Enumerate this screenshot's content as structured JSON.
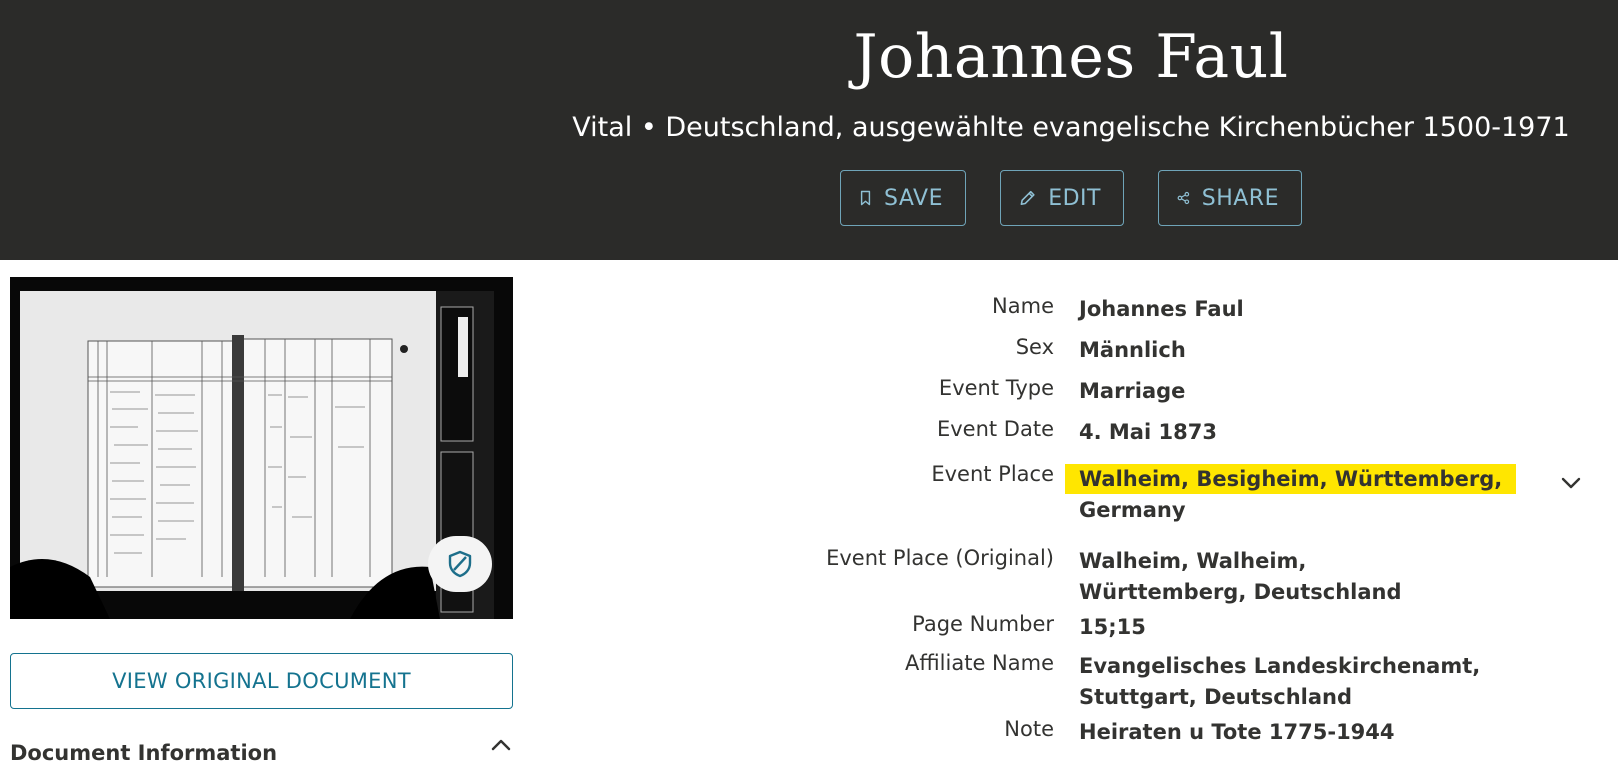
{
  "header": {
    "title": "Johannes Faul",
    "subtitle": "Vital • Deutschland, ausgewählte evangelische Kirchenbücher 1500-1971",
    "save_label": "SAVE",
    "edit_label": "EDIT",
    "share_label": "SHARE"
  },
  "document": {
    "view_original_label": "VIEW ORIGINAL DOCUMENT",
    "info_heading": "Document Information"
  },
  "facts": [
    {
      "label": "Name",
      "value": "Johannes Faul"
    },
    {
      "label": "Sex",
      "value": "Männlich"
    },
    {
      "label": "Event Type",
      "value": "Marriage"
    },
    {
      "label": "Event Date",
      "value": "4. Mai 1873"
    },
    {
      "label": "Event Place",
      "value_line1": "Walheim, Besigheim, Württemberg,",
      "value_line2": "Germany"
    },
    {
      "label": "Event Place (Original)",
      "value": "Walheim, Walheim, Württemberg, Deutschland"
    },
    {
      "label": "Page Number",
      "value": "15;15"
    },
    {
      "label": "Affiliate Name",
      "value": "Evangelisches Landeskirchenamt, Stuttgart, Deutschland"
    },
    {
      "label": "Note",
      "value": "Heiraten u Tote 1775-1944"
    }
  ],
  "colors": {
    "header_bg": "#2b2b29",
    "accent": "#14738f",
    "highlight": "#ffe600"
  },
  "icons": [
    "bookmark-icon",
    "pencil-icon",
    "share-icon",
    "shield-icon",
    "chevron-up-icon",
    "chevron-down-icon"
  ]
}
